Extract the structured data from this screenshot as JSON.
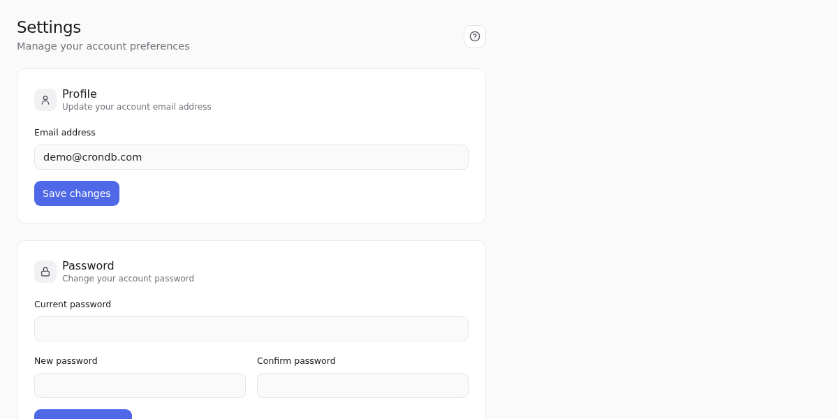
{
  "header": {
    "title": "Settings",
    "subtitle": "Manage your account preferences"
  },
  "profile": {
    "title": "Profile",
    "subtitle": "Update your account email address",
    "email_label": "Email address",
    "email_value": "demo@crondb.com",
    "save_button": "Save changes"
  },
  "password": {
    "title": "Password",
    "subtitle": "Change your account password",
    "fields": [
      {
        "label": "Current password",
        "kind": "wide"
      },
      {
        "label": "New password",
        "kind": "narrow"
      },
      {
        "label": "Confirm password",
        "kind": "narrow"
      }
    ]
  }
}
